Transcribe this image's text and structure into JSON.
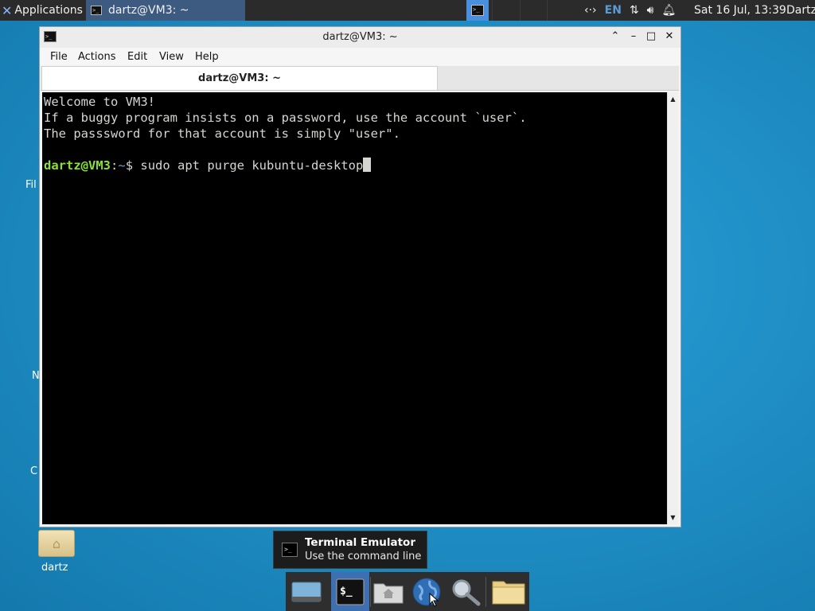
{
  "top_panel": {
    "applications_label": "Applications",
    "task_title": "dartz@VM3: ~",
    "keyboard_layout": "EN",
    "clock": "Sat 16 Jul, 13:39",
    "user": "Dartz"
  },
  "desktop": {
    "partial_labels": [
      "Fil",
      "N",
      "C"
    ],
    "home_folder_label": "dartz"
  },
  "window": {
    "title": "dartz@VM3: ~",
    "menu": [
      "File",
      "Actions",
      "Edit",
      "View",
      "Help"
    ],
    "tab_label": "dartz@VM3: ~",
    "terminal": {
      "lines": [
        "Welcome to VM3!",
        "If a buggy program insists on a password, use the account `user`.",
        "The passsword for that account is simply \"user\".",
        ""
      ],
      "prompt_user": "dartz@VM3",
      "prompt_sep": ":",
      "prompt_path": "~",
      "prompt_symbol": "$ ",
      "command": "sudo apt purge kubuntu-desktop"
    }
  },
  "tooltip": {
    "title": "Terminal Emulator",
    "subtitle": "Use the command line"
  },
  "dock": {
    "items": [
      "show-desktop",
      "terminal-emulator",
      "home-folder",
      "web-browser",
      "app-finder",
      "files"
    ]
  }
}
